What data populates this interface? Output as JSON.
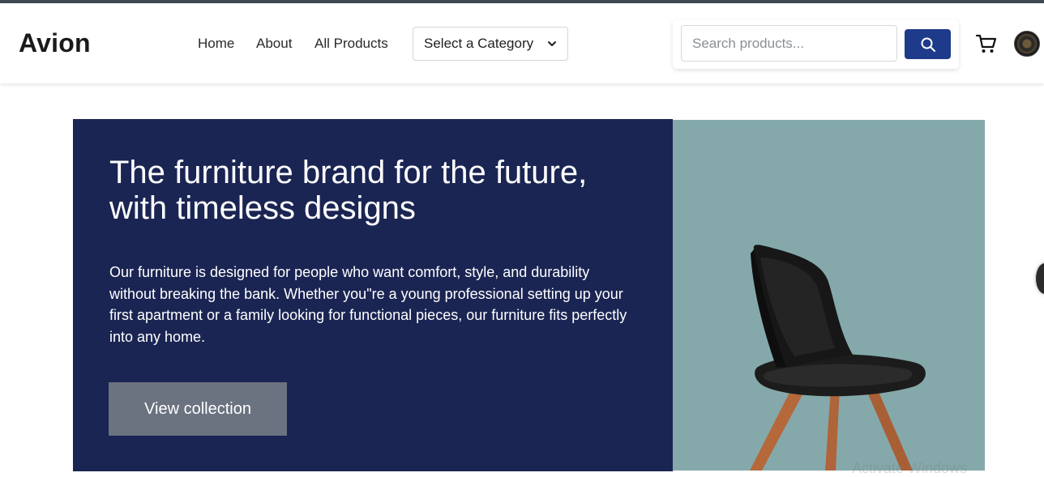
{
  "brand": {
    "logo": "Avion"
  },
  "nav": {
    "home": "Home",
    "about": "About",
    "all_products": "All Products"
  },
  "category_select": {
    "selected": "Select a Category"
  },
  "search": {
    "placeholder": "Search products..."
  },
  "icons": {
    "search": "search-icon",
    "cart": "cart-icon",
    "avatar": "avatar",
    "chevron": "chevron-down-icon"
  },
  "hero": {
    "title": "The furniture brand for the future, with timeless designs",
    "description": "Our furniture is designed for people who want comfort, style, and durability without breaking the bank. Whether you\"re a young professional setting up your first apartment or a family looking for functional pieces, our furniture fits perfectly into any home.",
    "cta": "View collection"
  },
  "overlay": {
    "watermark": "Activate Windows"
  },
  "colors": {
    "hero_bg": "#1b2553",
    "image_bg": "#85a9ab",
    "search_button": "#1e3a8a",
    "cta_bg": "#6b7280"
  }
}
